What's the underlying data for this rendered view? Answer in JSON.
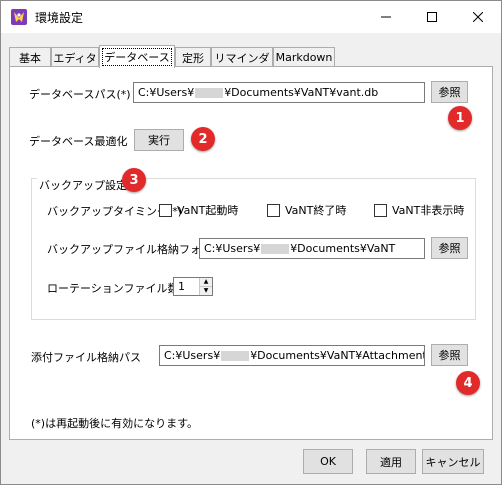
{
  "window": {
    "title": "環境設定",
    "minimize_icon": "minimize-icon",
    "maximize_icon": "maximize-icon",
    "close_icon": "close-icon"
  },
  "tabs": [
    {
      "label": "基本"
    },
    {
      "label": "エディタ"
    },
    {
      "label": "データベース",
      "active": true
    },
    {
      "label": "定形"
    },
    {
      "label": "リマインダ"
    },
    {
      "label": "Markdown"
    }
  ],
  "database": {
    "path_label": "データベースパス(*)",
    "path_prefix": "C:¥Users¥",
    "path_suffix": "¥Documents¥VaNT¥vant.db",
    "browse_label": "参照",
    "optimize_label": "データベース最適化",
    "run_label": "実行"
  },
  "backup": {
    "group_title": "バックアップ設定",
    "timing_label": "バックアップタイミング(*)",
    "checks": [
      {
        "label": "VaNT起動時",
        "checked": false
      },
      {
        "label": "VaNT終了時",
        "checked": false
      },
      {
        "label": "VaNT非表示時",
        "checked": false
      }
    ],
    "folder_label": "バックアップファイル格納フォルダ",
    "folder_prefix": "C:¥Users¥",
    "folder_suffix": "¥Documents¥VaNT",
    "browse_label": "参照",
    "rotation_label": "ローテーションファイル数",
    "rotation_value": "1"
  },
  "attachment": {
    "label": "添付ファイル格納パス",
    "path_prefix": "C:¥Users¥",
    "path_suffix": "¥Documents¥VaNT¥Attachment",
    "browse_label": "参照"
  },
  "note": "(*)は再起動後に有効になります。",
  "footer": {
    "ok_label": "OK",
    "apply_label": "適用",
    "cancel_label": "キャンセル"
  },
  "callouts": [
    "1",
    "2",
    "3",
    "4"
  ],
  "colors": {
    "callout": "#e22a2a",
    "window_bg": "#f0f0f0",
    "panel_bg": "#ffffff"
  }
}
